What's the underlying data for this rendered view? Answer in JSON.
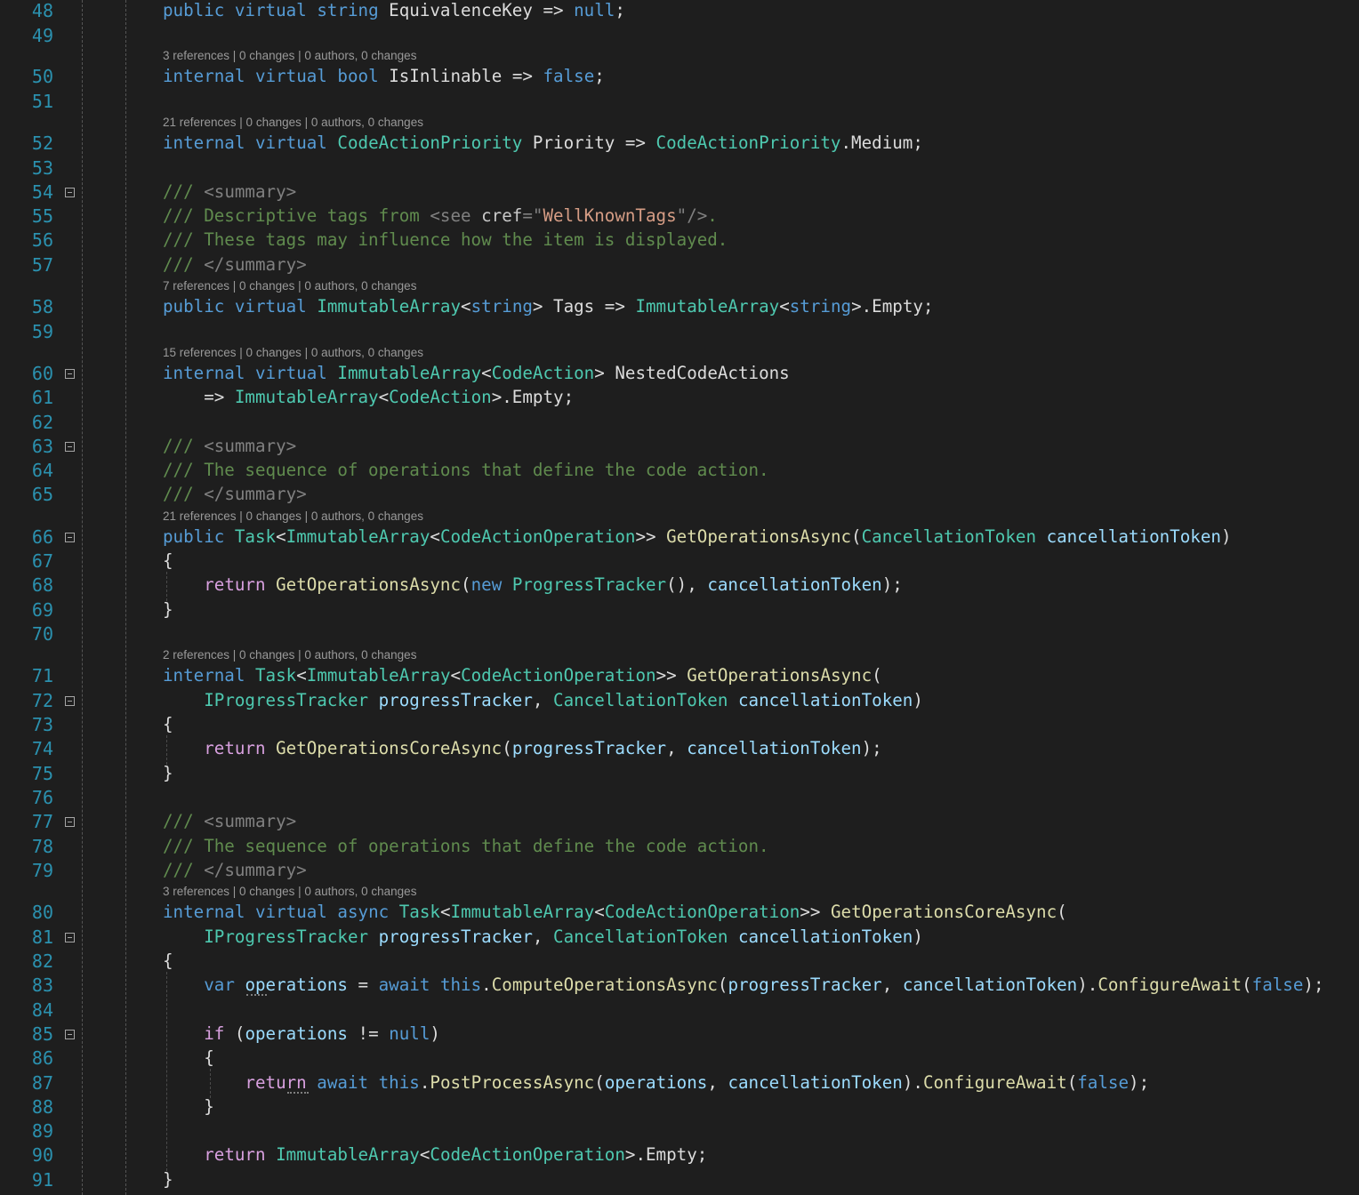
{
  "line_numbers": [
    "48",
    "49",
    "50",
    "51",
    "52",
    "53",
    "54",
    "55",
    "56",
    "57",
    "58",
    "59",
    "60",
    "61",
    "62",
    "63",
    "64",
    "65",
    "66",
    "67",
    "68",
    "69",
    "70",
    "71",
    "72",
    "73",
    "74",
    "75",
    "76",
    "77",
    "78",
    "79",
    "80",
    "81",
    "82",
    "83",
    "84",
    "85",
    "86",
    "87",
    "88",
    "89",
    "90",
    "91"
  ],
  "code_lens": [
    "3 references | 0 changes | 0 authors, 0 changes",
    "21 references | 0 changes | 0 authors, 0 changes",
    "7 references | 0 changes | 0 authors, 0 changes",
    "15 references | 0 changes | 0 authors, 0 changes",
    "21 references | 0 changes | 0 authors, 0 changes",
    "2 references | 0 changes | 0 authors, 0 changes",
    "3 references | 0 changes | 0 authors, 0 changes"
  ],
  "code_lines": [
    [
      [
        "kw",
        "public"
      ],
      [
        "tx",
        " "
      ],
      [
        "kw",
        "virtual"
      ],
      [
        "tx",
        " "
      ],
      [
        "kw",
        "string"
      ],
      [
        "tx",
        " EquivalenceKey => "
      ],
      [
        "kw",
        "null"
      ],
      [
        "tx",
        ";"
      ]
    ],
    [],
    [
      [
        "kw",
        "internal"
      ],
      [
        "tx",
        " "
      ],
      [
        "kw",
        "virtual"
      ],
      [
        "tx",
        " "
      ],
      [
        "kw",
        "bool"
      ],
      [
        "tx",
        " IsInlinable => "
      ],
      [
        "kw",
        "false"
      ],
      [
        "tx",
        ";"
      ]
    ],
    [],
    [
      [
        "kw",
        "internal"
      ],
      [
        "tx",
        " "
      ],
      [
        "kw",
        "virtual"
      ],
      [
        "tx",
        " "
      ],
      [
        "ty",
        "CodeActionPriority"
      ],
      [
        "tx",
        " Priority => "
      ],
      [
        "ty",
        "CodeActionPriority"
      ],
      [
        "tx",
        ".Medium;"
      ]
    ],
    [],
    [
      [
        "xd",
        "/// "
      ],
      [
        "dt",
        "<summary>"
      ]
    ],
    [
      [
        "xd",
        "/// Descriptive tags from "
      ],
      [
        "dt",
        "<see "
      ],
      [
        "xa",
        "cref"
      ],
      [
        "dt",
        "=\""
      ],
      [
        "xs",
        "WellKnownTags"
      ],
      [
        "dt",
        "\"/>"
      ],
      [
        "xd",
        "."
      ]
    ],
    [
      [
        "xd",
        "/// These tags may influence how the item is displayed."
      ]
    ],
    [
      [
        "xd",
        "/// "
      ],
      [
        "dt",
        "</summary>"
      ]
    ],
    [
      [
        "kw",
        "public"
      ],
      [
        "tx",
        " "
      ],
      [
        "kw",
        "virtual"
      ],
      [
        "tx",
        " "
      ],
      [
        "ty",
        "ImmutableArray"
      ],
      [
        "tx",
        "<"
      ],
      [
        "kw",
        "string"
      ],
      [
        "tx",
        "> Tags => "
      ],
      [
        "ty",
        "ImmutableArray"
      ],
      [
        "tx",
        "<"
      ],
      [
        "kw",
        "string"
      ],
      [
        "tx",
        ">.Empty;"
      ]
    ],
    [],
    [
      [
        "kw",
        "internal"
      ],
      [
        "tx",
        " "
      ],
      [
        "kw",
        "virtual"
      ],
      [
        "tx",
        " "
      ],
      [
        "ty",
        "ImmutableArray"
      ],
      [
        "tx",
        "<"
      ],
      [
        "ty",
        "CodeAction"
      ],
      [
        "tx",
        "> NestedCodeActions"
      ]
    ],
    [
      [
        "tx",
        "    => "
      ],
      [
        "ty",
        "ImmutableArray"
      ],
      [
        "tx",
        "<"
      ],
      [
        "ty",
        "CodeAction"
      ],
      [
        "tx",
        ">.Empty;"
      ]
    ],
    [],
    [
      [
        "xd",
        "/// "
      ],
      [
        "dt",
        "<summary>"
      ]
    ],
    [
      [
        "xd",
        "/// The sequence of operations that define the code action."
      ]
    ],
    [
      [
        "xd",
        "/// "
      ],
      [
        "dt",
        "</summary>"
      ]
    ],
    [
      [
        "kw",
        "public"
      ],
      [
        "tx",
        " "
      ],
      [
        "ty",
        "Task"
      ],
      [
        "tx",
        "<"
      ],
      [
        "ty",
        "ImmutableArray"
      ],
      [
        "tx",
        "<"
      ],
      [
        "ty",
        "CodeActionOperation"
      ],
      [
        "tx",
        ">> "
      ],
      [
        "mt",
        "GetOperationsAsync"
      ],
      [
        "tx",
        "("
      ],
      [
        "ty",
        "CancellationToken"
      ],
      [
        "tx",
        " "
      ],
      [
        "pm",
        "cancellationToken"
      ],
      [
        "tx",
        ")"
      ]
    ],
    [
      [
        "tx",
        "{"
      ]
    ],
    [
      [
        "tx",
        "    "
      ],
      [
        "kc",
        "return"
      ],
      [
        "tx",
        " "
      ],
      [
        "mt",
        "GetOperationsAsync"
      ],
      [
        "tx",
        "("
      ],
      [
        "kw",
        "new"
      ],
      [
        "tx",
        " "
      ],
      [
        "ty",
        "ProgressTracker"
      ],
      [
        "tx",
        "(), "
      ],
      [
        "pm",
        "cancellationToken"
      ],
      [
        "tx",
        ");"
      ]
    ],
    [
      [
        "tx",
        "}"
      ]
    ],
    [],
    [
      [
        "kw",
        "internal"
      ],
      [
        "tx",
        " "
      ],
      [
        "ty",
        "Task"
      ],
      [
        "tx",
        "<"
      ],
      [
        "ty",
        "ImmutableArray"
      ],
      [
        "tx",
        "<"
      ],
      [
        "ty",
        "CodeActionOperation"
      ],
      [
        "tx",
        ">> "
      ],
      [
        "mt",
        "GetOperationsAsync"
      ],
      [
        "tx",
        "("
      ]
    ],
    [
      [
        "tx",
        "    "
      ],
      [
        "ty",
        "IProgressTracker"
      ],
      [
        "tx",
        " "
      ],
      [
        "pm",
        "progressTracker"
      ],
      [
        "tx",
        ", "
      ],
      [
        "ty",
        "CancellationToken"
      ],
      [
        "tx",
        " "
      ],
      [
        "pm",
        "cancellationToken"
      ],
      [
        "tx",
        ")"
      ]
    ],
    [
      [
        "tx",
        "{"
      ]
    ],
    [
      [
        "tx",
        "    "
      ],
      [
        "kc",
        "return"
      ],
      [
        "tx",
        " "
      ],
      [
        "mt",
        "GetOperationsCoreAsync"
      ],
      [
        "tx",
        "("
      ],
      [
        "pm",
        "progressTracker"
      ],
      [
        "tx",
        ", "
      ],
      [
        "pm",
        "cancellationToken"
      ],
      [
        "tx",
        ");"
      ]
    ],
    [
      [
        "tx",
        "}"
      ]
    ],
    [],
    [
      [
        "xd",
        "/// "
      ],
      [
        "dt",
        "<summary>"
      ]
    ],
    [
      [
        "xd",
        "/// The sequence of operations that define the code action."
      ]
    ],
    [
      [
        "xd",
        "/// "
      ],
      [
        "dt",
        "</summary>"
      ]
    ],
    [
      [
        "kw",
        "internal"
      ],
      [
        "tx",
        " "
      ],
      [
        "kw",
        "virtual"
      ],
      [
        "tx",
        " "
      ],
      [
        "kw",
        "async"
      ],
      [
        "tx",
        " "
      ],
      [
        "ty",
        "Task"
      ],
      [
        "tx",
        "<"
      ],
      [
        "ty",
        "ImmutableArray"
      ],
      [
        "tx",
        "<"
      ],
      [
        "ty",
        "CodeActionOperation"
      ],
      [
        "tx",
        ">> "
      ],
      [
        "mt",
        "GetOperationsCoreAsync"
      ],
      [
        "tx",
        "("
      ]
    ],
    [
      [
        "tx",
        "    "
      ],
      [
        "ty",
        "IProgressTracker"
      ],
      [
        "tx",
        " "
      ],
      [
        "pm",
        "progressTracker"
      ],
      [
        "tx",
        ", "
      ],
      [
        "ty",
        "CancellationToken"
      ],
      [
        "tx",
        " "
      ],
      [
        "pm",
        "cancellationToken"
      ],
      [
        "tx",
        ")"
      ]
    ],
    [
      [
        "tx",
        "{"
      ]
    ],
    [
      [
        "tx",
        "    "
      ],
      [
        "kw",
        "var"
      ],
      [
        "tx",
        " "
      ],
      [
        "pm",
        "operations"
      ],
      [
        "tx",
        " = "
      ],
      [
        "kw",
        "await"
      ],
      [
        "tx",
        " "
      ],
      [
        "kw",
        "this"
      ],
      [
        "tx",
        "."
      ],
      [
        "mt",
        "ComputeOperationsAsync"
      ],
      [
        "tx",
        "("
      ],
      [
        "pm",
        "progressTracker"
      ],
      [
        "tx",
        ", "
      ],
      [
        "pm",
        "cancellationToken"
      ],
      [
        "tx",
        ")."
      ],
      [
        "mt",
        "ConfigureAwait"
      ],
      [
        "tx",
        "("
      ],
      [
        "kw",
        "false"
      ],
      [
        "tx",
        ");"
      ]
    ],
    [],
    [
      [
        "tx",
        "    "
      ],
      [
        "kc",
        "if"
      ],
      [
        "tx",
        " ("
      ],
      [
        "pm",
        "operations"
      ],
      [
        "tx",
        " != "
      ],
      [
        "kw",
        "null"
      ],
      [
        "tx",
        ")"
      ]
    ],
    [
      [
        "tx",
        "    {"
      ]
    ],
    [
      [
        "tx",
        "        "
      ],
      [
        "kc",
        "return"
      ],
      [
        "tx",
        " "
      ],
      [
        "kw",
        "await"
      ],
      [
        "tx",
        " "
      ],
      [
        "kw",
        "this"
      ],
      [
        "tx",
        "."
      ],
      [
        "mt",
        "PostProcessAsync"
      ],
      [
        "tx",
        "("
      ],
      [
        "pm",
        "operations"
      ],
      [
        "tx",
        ", "
      ],
      [
        "pm",
        "cancellationToken"
      ],
      [
        "tx",
        ")."
      ],
      [
        "mt",
        "ConfigureAwait"
      ],
      [
        "tx",
        "("
      ],
      [
        "kw",
        "false"
      ],
      [
        "tx",
        ");"
      ]
    ],
    [
      [
        "tx",
        "    }"
      ]
    ],
    [],
    [
      [
        "tx",
        "    "
      ],
      [
        "kc",
        "return"
      ],
      [
        "tx",
        " "
      ],
      [
        "ty",
        "ImmutableArray"
      ],
      [
        "tx",
        "<"
      ],
      [
        "ty",
        "CodeActionOperation"
      ],
      [
        "tx",
        ">.Empty;"
      ]
    ],
    [
      [
        "tx",
        "}"
      ]
    ]
  ],
  "colors": {
    "background": "#1e1e1e",
    "line_number": "#2b91af",
    "keyword": "#569cd6",
    "control_keyword": "#d8a0df",
    "type": "#4ec9b0",
    "method": "#dcdcaa",
    "parameter": "#9cdcfe",
    "xml_doc_comment": "#608b4e",
    "plain_text": "#dcdcdc",
    "code_lens": "#999999"
  },
  "icons": {
    "fold_toggle": "collapse-minus-icon"
  }
}
